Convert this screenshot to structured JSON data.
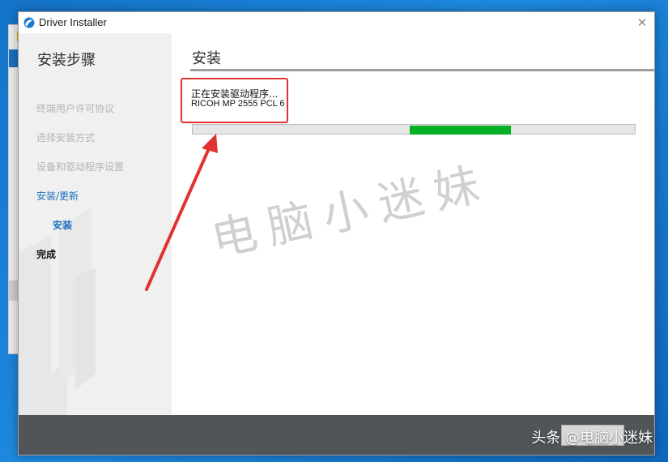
{
  "window": {
    "title": "Driver Installer",
    "close_symbol": "✕"
  },
  "sidebar": {
    "title": "安装步骤",
    "steps": [
      {
        "label": "终端用户许可协议",
        "state": "inactive"
      },
      {
        "label": "选择安装方式",
        "state": "inactive"
      },
      {
        "label": "设备和驱动程序设置",
        "state": "inactive"
      },
      {
        "label": "安装/更新",
        "state": "active"
      },
      {
        "label": "安装",
        "state": "current-sub"
      },
      {
        "label": "完成",
        "state": "upcoming"
      }
    ]
  },
  "content": {
    "section_title": "安装",
    "status_text": "正在安装驱动程序...",
    "device_name": "RICOH MP 2555 PCL 6",
    "progress": {
      "indeterminate_segment_start": 0.49,
      "indeterminate_segment_end": 0.72
    }
  },
  "watermark": {
    "text": "电脑小迷妹"
  },
  "footer": {
    "watermark": "头条 @电脑小迷妹"
  },
  "colors": {
    "progress": "#06b025",
    "annotation": "#e03232",
    "active_step": "#1e6fbd",
    "footer": "#515558"
  },
  "icons": {
    "app": "app-swoosh-icon",
    "close": "close-icon",
    "annotation_arrow": "red-arrow-icon"
  }
}
